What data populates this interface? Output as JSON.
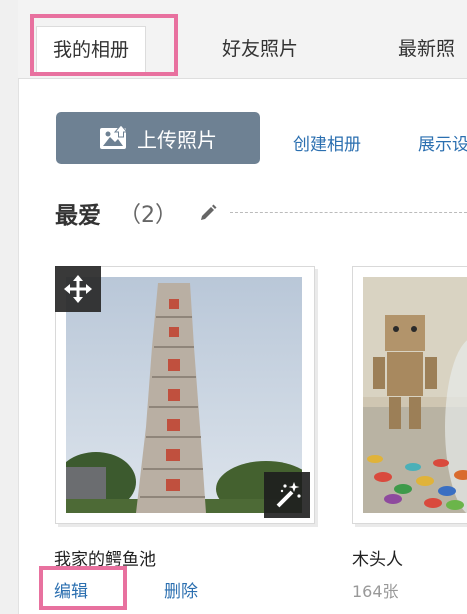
{
  "tabs": [
    {
      "label": "我的相册",
      "active": true
    },
    {
      "label": "好友照片",
      "active": false
    },
    {
      "label": "最新照",
      "active": false
    }
  ],
  "toolbar": {
    "upload_label": "上传照片",
    "upload_icon": "image-upload-icon",
    "create_album": "创建相册",
    "display": "展示设"
  },
  "section": {
    "title": "最爱",
    "count": "（2）",
    "edit_icon": "pencil-icon"
  },
  "albums": [
    {
      "name": "我家的鳄鱼池",
      "edit": "编辑",
      "delete": "删除"
    },
    {
      "name": "木头人",
      "count": "164张"
    }
  ],
  "colors": {
    "highlight": "#e8719f",
    "link": "#2b6fb0",
    "upload_button": "#6e8193"
  }
}
